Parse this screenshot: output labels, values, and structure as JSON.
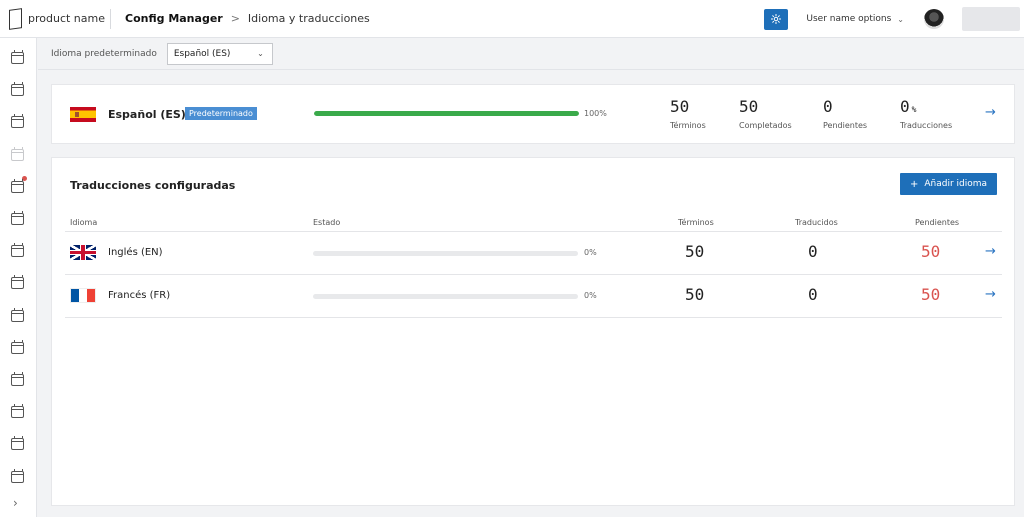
{
  "header": {
    "product_name": "product name",
    "app_name": "Config Manager",
    "breadcrumb_sep": ">",
    "page_title": "Idioma y traducciones",
    "user_options_label": "User name options",
    "accent_color": "#1e6fb9"
  },
  "sidebar": {
    "icons": [
      "calendar-icon",
      "calendar-icon",
      "calendar-icon",
      "calendar-icon",
      "calendar-icon",
      "calendar-icon",
      "calendar-icon",
      "calendar-icon",
      "calendar-icon",
      "calendar-icon",
      "calendar-icon",
      "calendar-icon",
      "calendar-icon",
      "calendar-icon"
    ],
    "expand_icon": "chevron-right-icon"
  },
  "toolbar": {
    "default_language_label": "Idioma predeterminado",
    "default_language_value": "Español (ES)"
  },
  "default_language": {
    "name": "Español (ES)",
    "badge": "Predeterminado",
    "progress_percent": 100,
    "progress_label": "100%",
    "stats": [
      {
        "value": "50",
        "unit": "",
        "label": "Términos"
      },
      {
        "value": "50",
        "unit": "",
        "label": "Completados"
      },
      {
        "value": "0",
        "unit": "",
        "label": "Pendientes"
      },
      {
        "value": "0",
        "unit": "%",
        "label": "Traducciones"
      }
    ],
    "progress_color": "#3aaa4a"
  },
  "translations": {
    "title": "Traducciones configuradas",
    "add_button": "Añadir idioma",
    "columns": {
      "language": "Idioma",
      "status": "Estado",
      "terms": "Términos",
      "translated": "Traducidos",
      "pending": "Pendientes"
    },
    "rows": [
      {
        "flag": "uk-flag-icon",
        "name": "Inglés (EN)",
        "progress_percent": 0,
        "progress_label": "0%",
        "terms": "50",
        "translated": "0",
        "pending": "50"
      },
      {
        "flag": "france-flag-icon",
        "name": "Francés (FR)",
        "progress_percent": 0,
        "progress_label": "0%",
        "terms": "50",
        "translated": "0",
        "pending": "50"
      }
    ],
    "pending_color": "#d9534f"
  }
}
